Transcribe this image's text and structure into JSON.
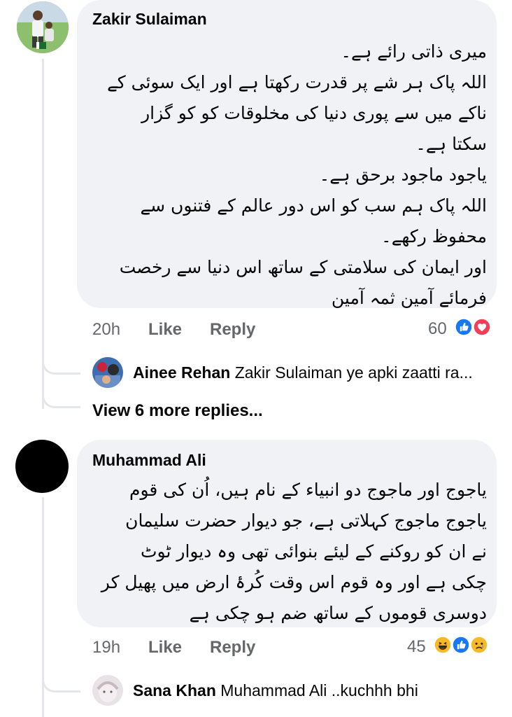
{
  "comments": [
    {
      "author": "Zakir Sulaiman",
      "lines": [
        "میری ذاتی رائے ہے۔",
        "اللہ پاک ہر شے پر قدرت رکھتا ہے اور ایک سوئی کے",
        "ناکے میں سے پوری دنیا کی مخلوقات کو کو گزار",
        "سکتا ہے۔",
        "یاجود ماجود برحق ہے۔",
        "اللہ پاک ہم سب کو اس دور عالم کے فتنوں سے",
        "محفوظ رکھے۔",
        "اور ایمان کی سلامتی کے ساتھ اس دنیا سے رخصت",
        "فرمائے آمین ثمہ آمین"
      ],
      "time": "20h",
      "like_label": "Like",
      "reply_label": "Reply",
      "reaction_count": "60",
      "reactions": [
        "like-icon",
        "love-icon"
      ],
      "reply": {
        "author": "Ainee Rehan",
        "text": "Zakir Sulaiman ye apki zaatti ra..."
      },
      "more_replies": "View 6 more replies..."
    },
    {
      "author": "Muhammad Ali",
      "lines": [
        "یاجوج اور ماجوج دو انبیاء کے نام ہیں، اُن کی قوم",
        "یاجوج ماجوج کہلاتی ہے، جو دیوار حضرت سلیمان",
        "نے ان کو روکنے کے لیئے بنوائی تھی وہ دیوار ٹوٹ",
        "چکی ہے اور وہ قوم اس وقت کُرۂ ارض میں پھیل کر",
        "دوسری قوموں کے ساتھ ضم ہو چکی ہے"
      ],
      "time": "19h",
      "like_label": "Like",
      "reply_label": "Reply",
      "reaction_count": "45",
      "reactions": [
        "haha-icon",
        "like-icon",
        "sad-icon"
      ],
      "reply": {
        "author": "Sana Khan",
        "text": "Muhammad Ali ..kuchhh bhi"
      }
    }
  ],
  "colors": {
    "bubble": "#f0f2f5",
    "secondary_text": "#65676b",
    "like_blue": "#1877f2",
    "love_red": "#f33e58",
    "haha_yellow": "#f7b928"
  }
}
